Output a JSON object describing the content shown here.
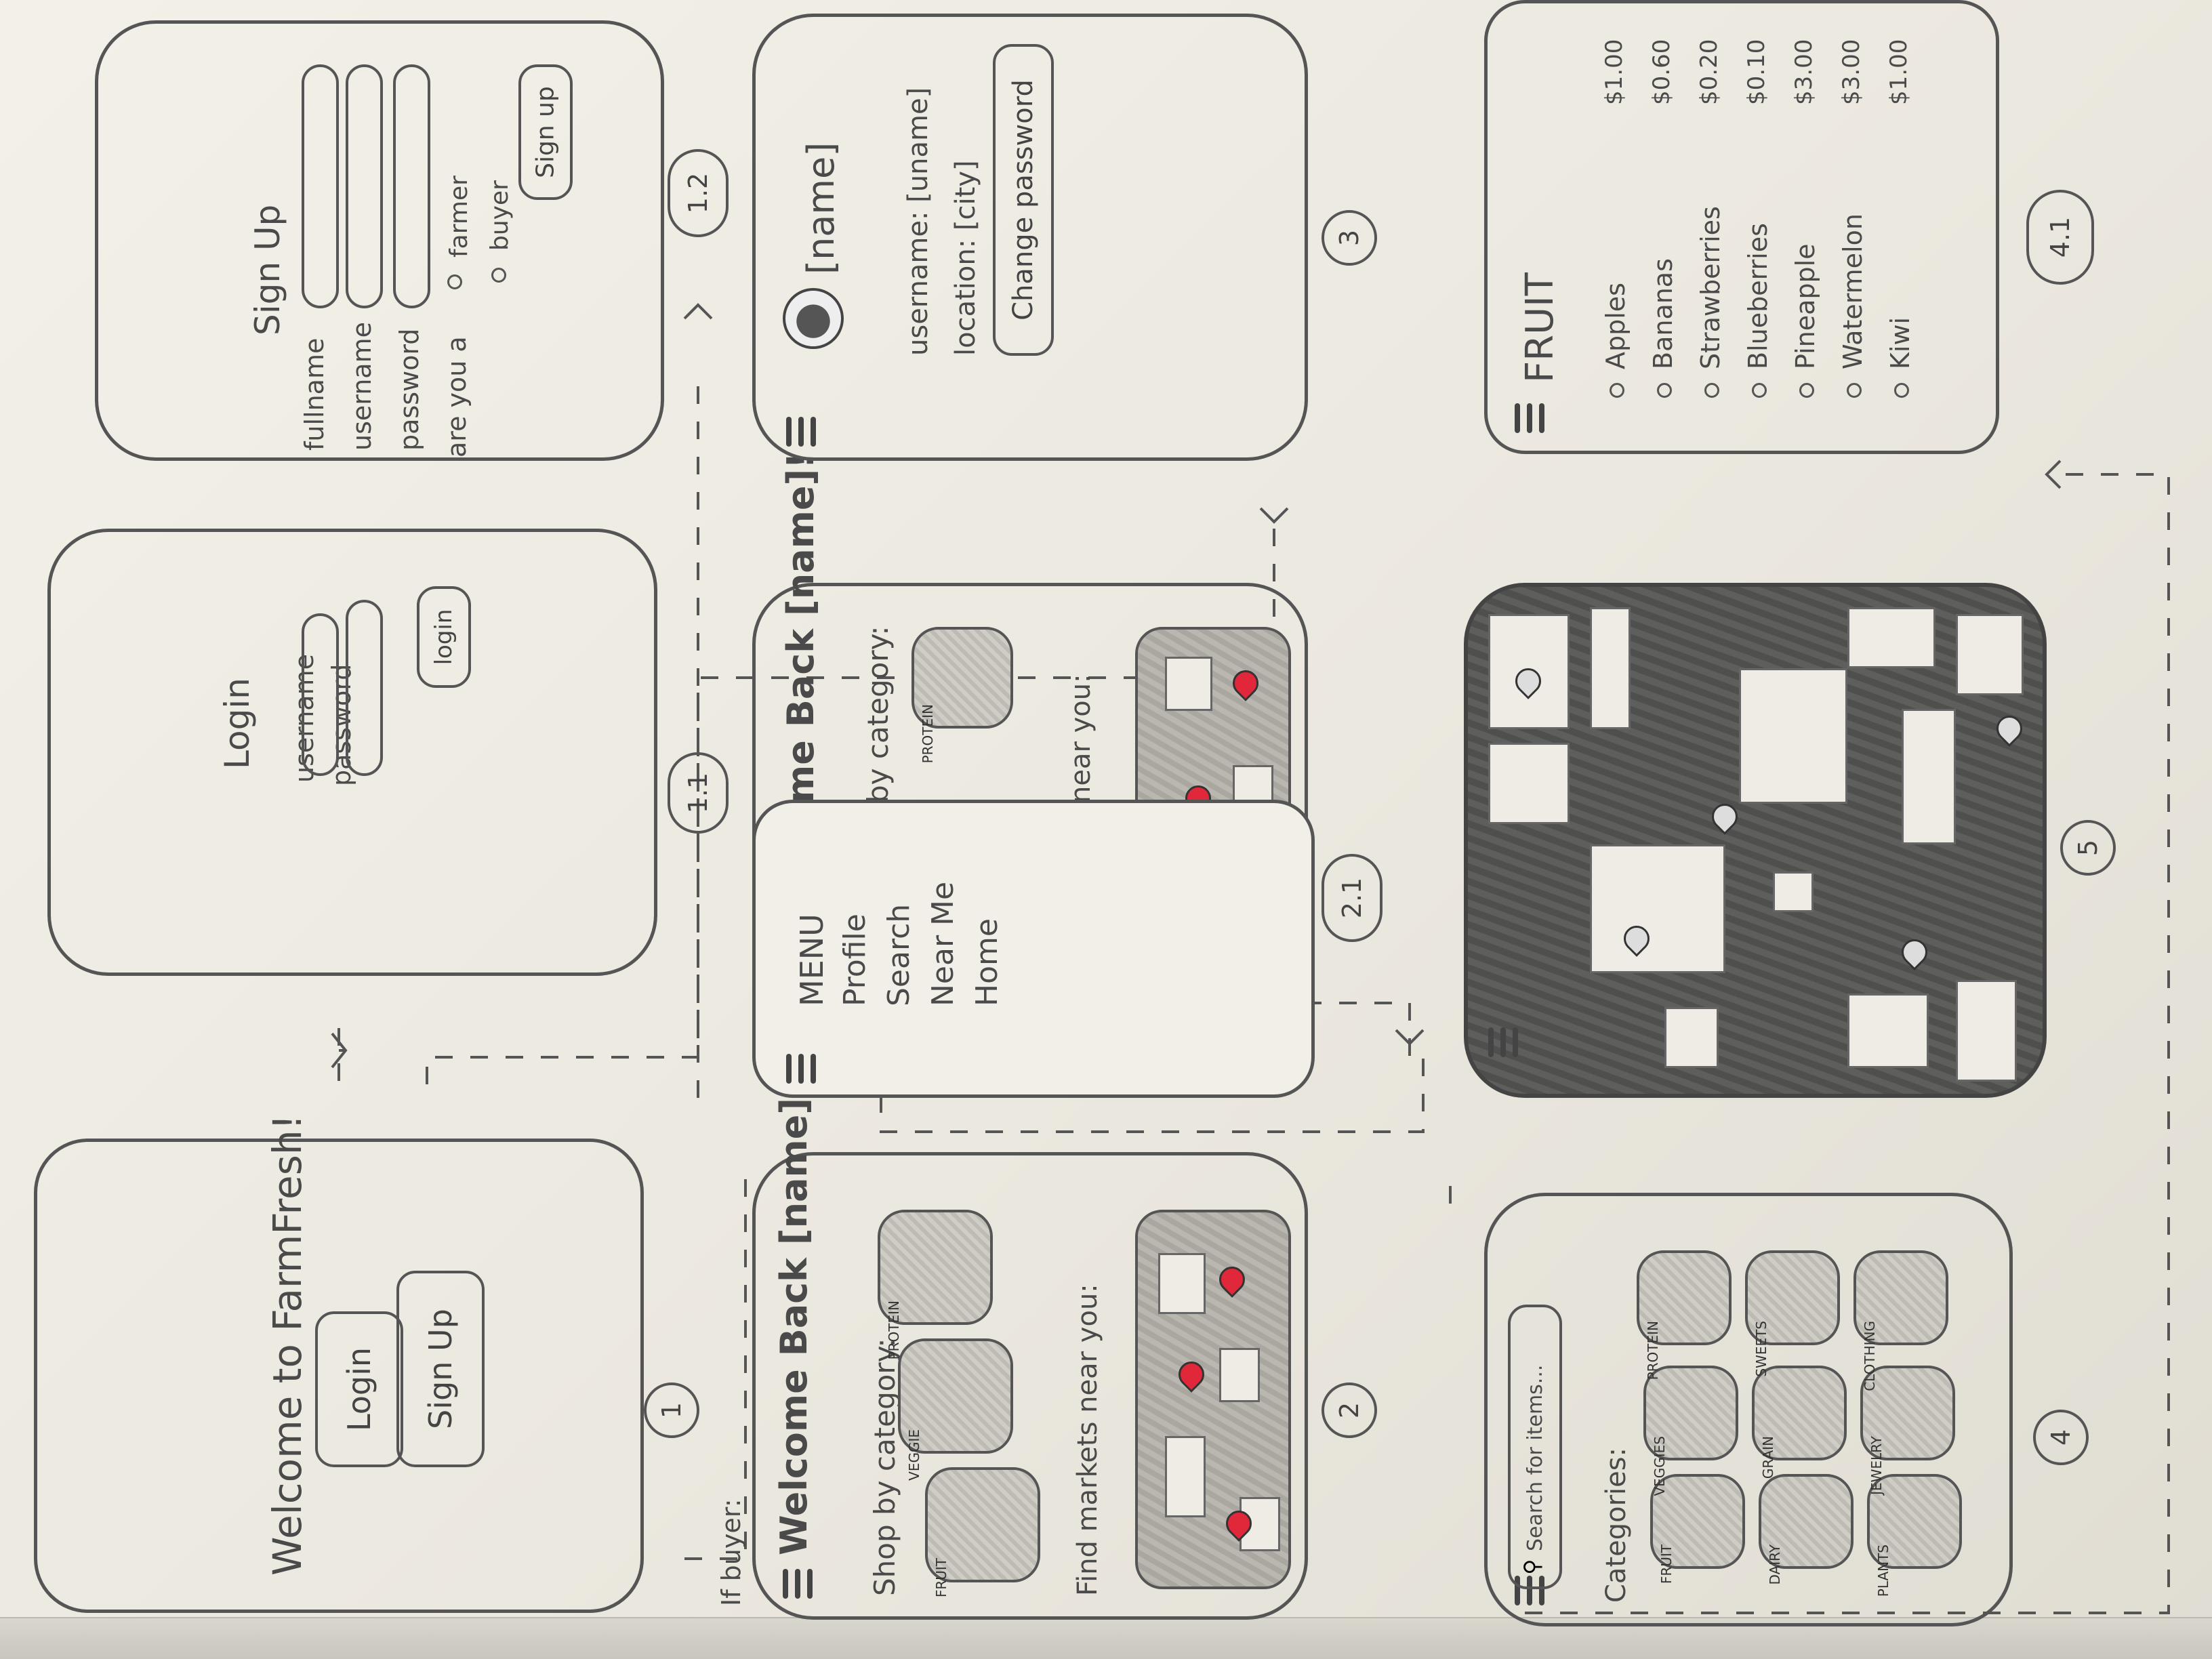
{
  "screens": {
    "s1": {
      "title": "Welcome to FarmFresh!",
      "login_button": "Login",
      "signup_button": "Sign Up",
      "number": "1"
    },
    "s11": {
      "title": "Login",
      "username_label": "username",
      "password_label": "password",
      "login_button": "login",
      "number": "1.1"
    },
    "s12": {
      "title": "Sign Up",
      "fullname_label": "fullname",
      "username_label": "username",
      "password_label": "password",
      "question": "are you a",
      "option_farmer": "farmer",
      "option_buyer": "buyer",
      "signup_button": "Sign up",
      "number": "1.2"
    },
    "s2": {
      "condition": "If buyer:",
      "welcome": "Welcome Back [name]!",
      "shop_label": "Shop by category:",
      "categories": [
        "FRUIT",
        "VEGGIE",
        "PROTEIN"
      ],
      "markets_label": "Find markets near you:",
      "number": "2"
    },
    "s21": {
      "welcome": "me Back [name]!",
      "shop_label": "by category:",
      "category": "PROTEIN",
      "markets_label": "near you:",
      "menu_title": "MENU",
      "menu_items": [
        "Profile",
        "Search",
        "Near Me",
        "Home"
      ],
      "number": "2.1"
    },
    "s3": {
      "name": "[name]",
      "username": "username: [uname]",
      "location": "location: [city]",
      "change_password": "Change password",
      "number": "3"
    },
    "s4": {
      "search_placeholder": "Search for items...",
      "categories_label": "Categories:",
      "categories": [
        "FRUIT",
        "VEGGIES",
        "PROTEIN",
        "DAIRY",
        "GRAIN",
        "SWEETS",
        "PLANTS",
        "JEWELRY",
        "CLOTHING"
      ],
      "number": "4"
    },
    "s41": {
      "title": "FRUIT",
      "items": [
        {
          "name": "Apples",
          "price": "$1.00"
        },
        {
          "name": "Bananas",
          "price": "$0.60"
        },
        {
          "name": "Strawberries",
          "price": "$0.20"
        },
        {
          "name": "Blueberries",
          "price": "$0.10"
        },
        {
          "name": "Pineapple",
          "price": "$3.00"
        },
        {
          "name": "Watermelon",
          "price": "$3.00"
        },
        {
          "name": "Kiwi",
          "price": "$1.00"
        }
      ],
      "number": "4.1"
    },
    "s5": {
      "number": "5"
    }
  },
  "colors": {
    "pencil": "#555555",
    "pin": "#e0283a",
    "paper": "#f2f0e8"
  }
}
